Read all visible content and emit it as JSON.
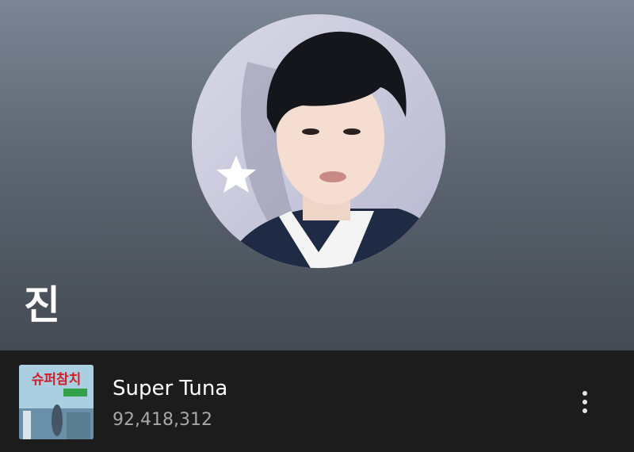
{
  "artist": {
    "name": "진"
  },
  "track": {
    "title": "Super Tuna",
    "plays": "92,418,312",
    "cover_text": "슈퍼참치"
  },
  "icons": {
    "more": "more-vertical-icon",
    "star": "star-icon"
  },
  "colors": {
    "header_top": "#7b8594",
    "header_bottom": "#434a53",
    "track_bg": "#1c1c1c",
    "secondary_text": "#a7a7a7"
  }
}
